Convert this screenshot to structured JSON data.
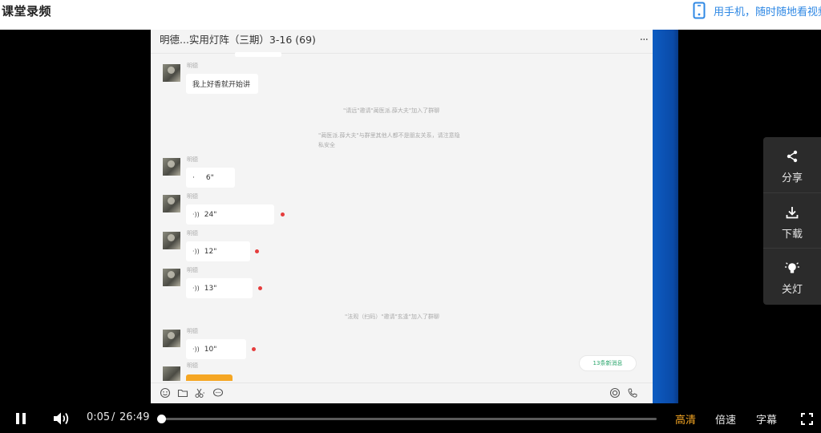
{
  "header": {
    "title": "课堂录频",
    "mobile_promo": "用手机，随时随地看视频",
    "mobile_icon": "phone-icon"
  },
  "chat": {
    "title": "明德...实用灯阵（三期）3-16 (69)",
    "more": "...",
    "sender_name": "明德",
    "messages": [
      {
        "type": "text",
        "sender": "明德",
        "text": "我上好香就开始讲"
      },
      {
        "type": "voice",
        "sender": "明德",
        "duration": "6\"",
        "unread": false
      },
      {
        "type": "voice",
        "sender": "明德",
        "duration": "24\"",
        "unread": true
      },
      {
        "type": "voice",
        "sender": "明德",
        "duration": "12\"",
        "unread": true
      },
      {
        "type": "voice",
        "sender": "明德",
        "duration": "13\"",
        "unread": true
      },
      {
        "type": "voice",
        "sender": "明德",
        "duration": "10\"",
        "unread": true
      }
    ],
    "system_notes": [
      "\"请远\"邀请\"蔺医派.薛大夫\"加入了群聊",
      "\"蔺医派.薛大夫\"与群里其他人都不是朋友关系，请注意隐",
      "私安全",
      "\"法观（扫码）\"邀请\"玄逢\"加入了群聊"
    ],
    "new_messages": "13条新消息",
    "voice_icon": "·))",
    "dot_mark": "·"
  },
  "side_panel": {
    "items": [
      {
        "label": "分享",
        "icon": "share-icon"
      },
      {
        "label": "下载",
        "icon": "download-icon"
      },
      {
        "label": "关灯",
        "icon": "lightbulb-icon"
      }
    ]
  },
  "player": {
    "current_time": "0:05",
    "separator": "/",
    "total_time": "26:49",
    "progress": 0.003,
    "quality_label": "高清",
    "speed_label": "倍速",
    "subtitle_label": "字幕",
    "accent_color": "#f5a623"
  }
}
